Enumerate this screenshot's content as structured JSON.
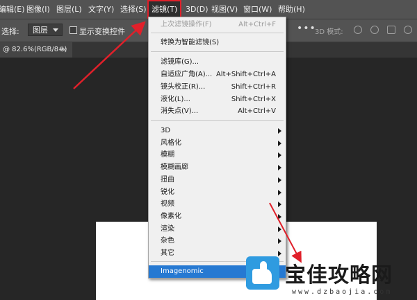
{
  "menubar": {
    "items": [
      "编辑(E)",
      "图像(I)",
      "图层(L)",
      "文字(Y)",
      "选择(S)",
      "滤镜(T)",
      "3D(D)",
      "视图(V)",
      "窗口(W)",
      "帮助(H)"
    ]
  },
  "options": {
    "auto_select_label": "选择:",
    "auto_select_value": "图层",
    "show_transform_label": "显示变换控件",
    "more": "•••",
    "mode_3d_label": "3D 模式:"
  },
  "tab": {
    "title": "@ 82.6%(RGB/8#)",
    "close": "×"
  },
  "filter_menu": {
    "last_filter": {
      "label": "上次滤镜操作(F)",
      "shortcut": "Alt+Ctrl+F"
    },
    "smart_filter": {
      "label": "转换为智能滤镜(S)"
    },
    "group1": [
      {
        "label": "滤镜库(G)...",
        "shortcut": ""
      },
      {
        "label": "自适应广角(A)...",
        "shortcut": "Alt+Shift+Ctrl+A"
      },
      {
        "label": "镜头校正(R)...",
        "shortcut": "Shift+Ctrl+R"
      },
      {
        "label": "液化(L)...",
        "shortcut": "Shift+Ctrl+X"
      },
      {
        "label": "消失点(V)...",
        "shortcut": "Alt+Ctrl+V"
      }
    ],
    "submenus": [
      "3D",
      "风格化",
      "模糊",
      "模糊画廊",
      "扭曲",
      "锐化",
      "视频",
      "像素化",
      "渲染",
      "杂色",
      "其它"
    ],
    "plugin": "Imagenomic"
  },
  "watermark": {
    "brand": "宝佳攻略网",
    "url": "www.dzbaojia.com"
  },
  "colors": {
    "highlight": "#2679d2",
    "annotation_red": "#e0202a"
  }
}
